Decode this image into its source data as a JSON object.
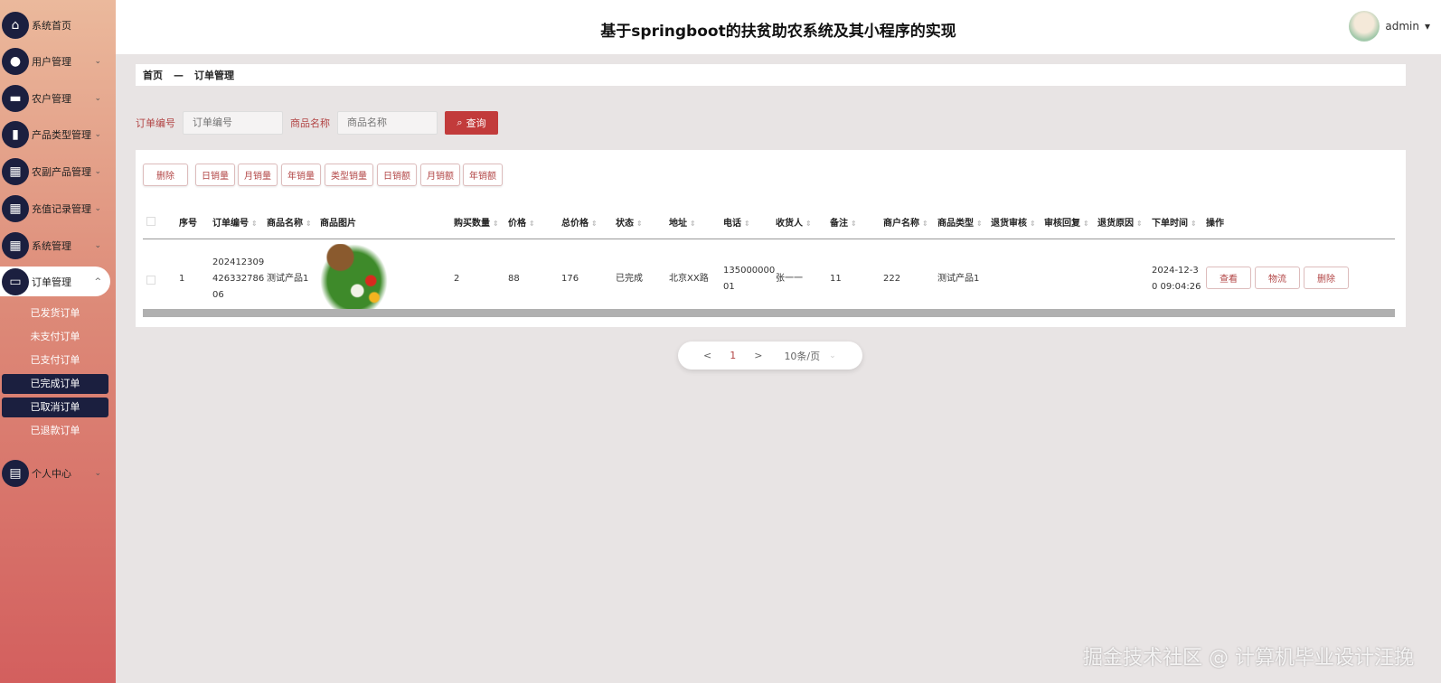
{
  "header": {
    "title": "基于springboot的扶贫助农系统及其小程序的实现",
    "user": "admin"
  },
  "sidebar": {
    "items": [
      {
        "label": "系统首页",
        "icon": "home-icon"
      },
      {
        "label": "用户管理",
        "icon": "user-icon"
      },
      {
        "label": "农户管理",
        "icon": "monitor-icon"
      },
      {
        "label": "产品类型管理",
        "icon": "bar-chart-icon"
      },
      {
        "label": "农副产品管理",
        "icon": "grid-icon"
      },
      {
        "label": "充值记录管理",
        "icon": "grid-icon"
      },
      {
        "label": "系统管理",
        "icon": "grid-icon"
      },
      {
        "label": "订单管理",
        "icon": "order-icon"
      },
      {
        "label": "个人中心",
        "icon": "card-icon"
      }
    ],
    "sub_items": [
      "已发货订单",
      "未支付订单",
      "已支付订单",
      "已完成订单",
      "已取消订单",
      "已退款订单"
    ]
  },
  "breadcrumb": {
    "home": "首页",
    "sep": "—",
    "current": "订单管理"
  },
  "search": {
    "order_no_label": "订单编号",
    "order_no_placeholder": "订单编号",
    "product_label": "商品名称",
    "product_placeholder": "商品名称",
    "query": "查询"
  },
  "toolbar": [
    "删除",
    "日销量",
    "月销量",
    "年销量",
    "类型销量",
    "日销额",
    "月销额",
    "年销额"
  ],
  "table": {
    "headers": [
      "序号",
      "订单编号",
      "商品名称",
      "商品图片",
      "购买数量",
      "价格",
      "总价格",
      "状态",
      "地址",
      "电话",
      "收货人",
      "备注",
      "商户名称",
      "商品类型",
      "退货审核",
      "审核回复",
      "退货原因",
      "下单时间",
      "操作"
    ],
    "row": {
      "index": "1",
      "order_no": "202412309426332786 06",
      "order_no_lines": [
        "202412309",
        "426332786",
        "06"
      ],
      "product": "测试产品1",
      "qty": "2",
      "price": "88",
      "total": "176",
      "status": "已完成",
      "address": "北京XX路",
      "phone_lines": [
        "135000000",
        "01"
      ],
      "receiver": "张一一",
      "note": "11",
      "merchant": "222",
      "type": "测试产品1",
      "time_lines": [
        "2024-12-3",
        "0 09:04:26"
      ],
      "actions": [
        "查看",
        "物流",
        "删除"
      ]
    }
  },
  "pagination": {
    "prev": "<",
    "page": "1",
    "next": ">",
    "size": "10条/页"
  },
  "watermark": "掘金技术社区 @ 计算机毕业设计汪挽"
}
